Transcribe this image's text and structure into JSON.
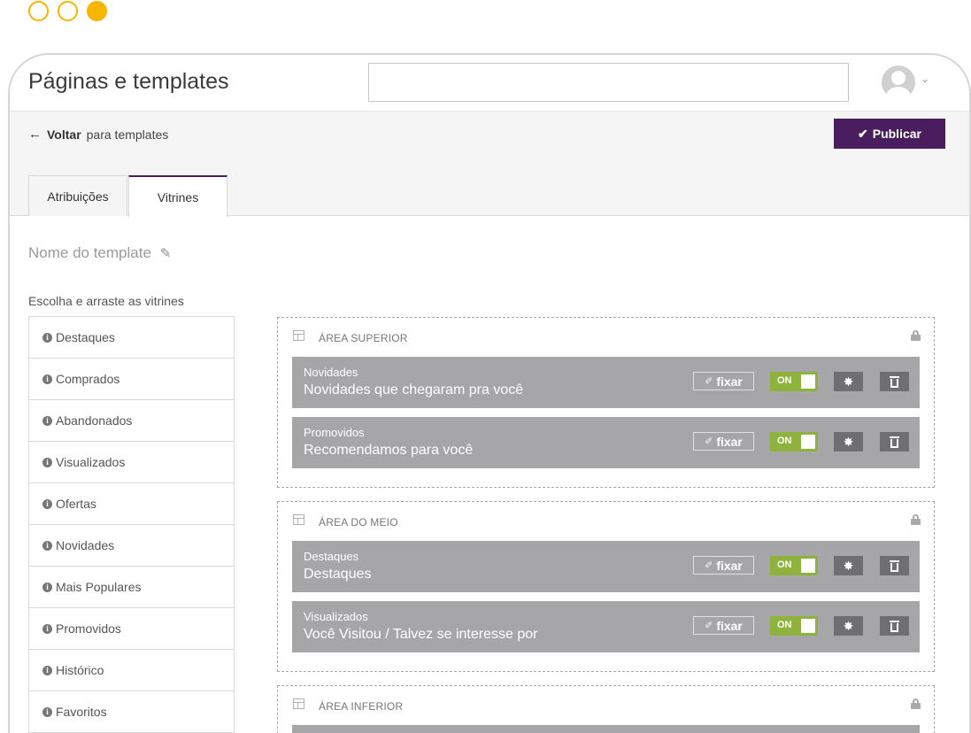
{
  "window_controls": [
    "minimize",
    "maximize",
    "close"
  ],
  "app": {
    "title": "Páginas e templates"
  },
  "search": {
    "value": "",
    "placeholder": ""
  },
  "user": {
    "avatar_icon": "user-avatar-icon",
    "caret": "⌄"
  },
  "subbar": {
    "back_arrow": "←",
    "back_label": "Voltar",
    "back_suffix": "para templates",
    "publish_check": "✔",
    "publish_label": "Publicar"
  },
  "colors": {
    "accent": "#4a1d5e",
    "toggle_on": "#8fb23f",
    "row_bg": "#a6a5a7",
    "window_dot": "#f6b600"
  },
  "tabs": [
    {
      "label": "Atribuições",
      "active": false
    },
    {
      "label": "Vitrines",
      "active": true
    }
  ],
  "template": {
    "name": "Nome do template"
  },
  "vitrines": {
    "heading": "Escolha e arraste as vitrines",
    "items": [
      {
        "label": "Destaques"
      },
      {
        "label": "Comprados"
      },
      {
        "label": "Abandonados"
      },
      {
        "label": "Visualizados"
      },
      {
        "label": "Ofertas"
      },
      {
        "label": "Novidades"
      },
      {
        "label": "Mais Populares"
      },
      {
        "label": "Promovidos"
      },
      {
        "label": "Histórico"
      },
      {
        "label": "Favoritos"
      }
    ]
  },
  "areas": [
    {
      "title": "ÁREA SUPERIOR",
      "rows": [
        {
          "label": "Novidades",
          "title": "Novidades que chegaram pra você",
          "fix_label": "fixar",
          "toggle": "ON"
        },
        {
          "label": "Promovidos",
          "title": "Recomendamos para você",
          "fix_label": "fixar",
          "toggle": "ON"
        }
      ]
    },
    {
      "title": "ÁREA DO MEIO",
      "rows": [
        {
          "label": "Destaques",
          "title": "Destaques",
          "fix_label": "fixar",
          "toggle": "ON"
        },
        {
          "label": "Visualizados",
          "title": "Você Visitou / Talvez se interesse por",
          "fix_label": "fixar",
          "toggle": "ON"
        }
      ]
    },
    {
      "title": "ÁREA INFERIOR",
      "rows": []
    }
  ]
}
